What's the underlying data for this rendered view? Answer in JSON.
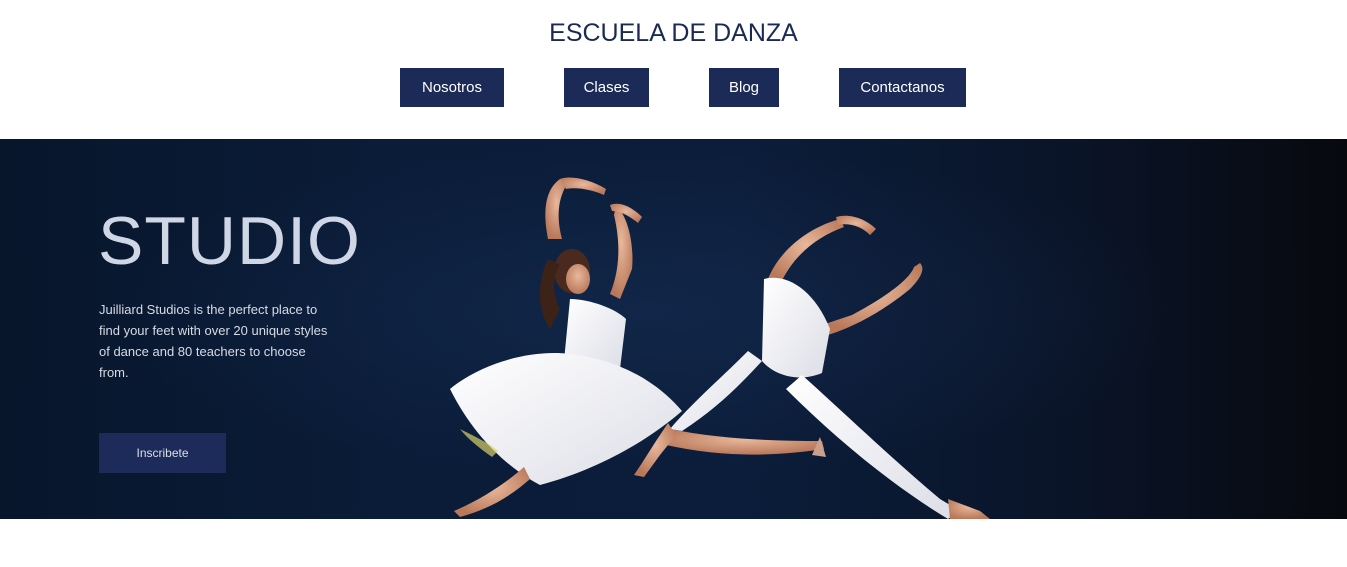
{
  "header": {
    "site_title": "ESCUELA DE DANZA",
    "nav": [
      {
        "label": "Nosotros"
      },
      {
        "label": "Clases"
      },
      {
        "label": "Blog"
      },
      {
        "label": "Contactanos"
      }
    ]
  },
  "hero": {
    "title": "STUDIO",
    "description": "Juilliard Studios is the perfect place to find your feet with over 20 unique styles of dance and 80 teachers to choose from.",
    "cta_label": "Inscribete",
    "image_subject": "two-dancers-leaping-photo"
  },
  "colors": {
    "brand_navy": "#1c2a57",
    "title_text": "#1b2a55",
    "hero_background": "#0a1c38"
  }
}
